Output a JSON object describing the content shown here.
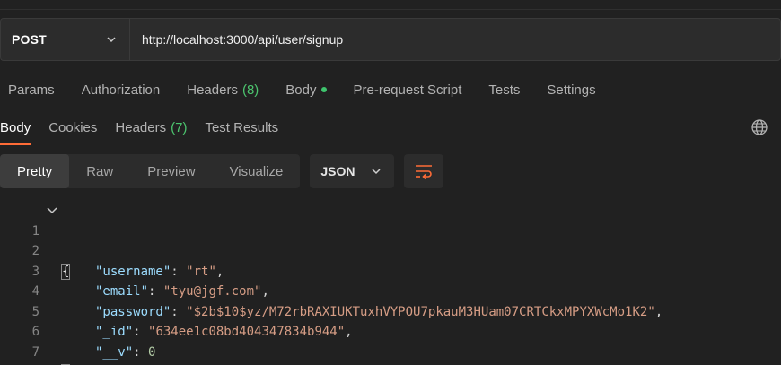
{
  "request": {
    "method": "POST",
    "url": "http://localhost:3000/api/user/signup"
  },
  "request_tabs": {
    "params": "Params",
    "authorization": "Authorization",
    "headers": "Headers",
    "headers_count": "(8)",
    "body": "Body",
    "prerequest": "Pre-request Script",
    "tests": "Tests",
    "settings": "Settings"
  },
  "response_tabs": {
    "body": "Body",
    "cookies": "Cookies",
    "headers": "Headers",
    "headers_count": "(7)",
    "test_results": "Test Results"
  },
  "view_modes": {
    "pretty": "Pretty",
    "raw": "Raw",
    "preview": "Preview",
    "visualize": "Visualize",
    "active": "Pretty"
  },
  "format": "JSON",
  "editor": {
    "line_numbers": [
      "1",
      "2",
      "3",
      "4",
      "5",
      "6",
      "7"
    ],
    "open_brace": "{",
    "close_brace": "}",
    "fields": [
      {
        "key": "\"username\"",
        "value": "\"rt\"",
        "type": "string",
        "comma": ","
      },
      {
        "key": "\"email\"",
        "value": "\"tyu@jgf.com\"",
        "type": "string",
        "comma": ","
      },
      {
        "key": "\"password\"",
        "value_prefix": "\"$2b$10$yz",
        "value_link": "/M72rbRAXIUKTuxhVYPOU7pkauM3HUam07CRTCkxMPYXWcMo1K2",
        "value_suffix": "\"",
        "type": "string",
        "comma": ","
      },
      {
        "key": "\"_id\"",
        "value": "\"634ee1c08bd404347834b944\"",
        "type": "string",
        "comma": ","
      },
      {
        "key": "\"__v\"",
        "value": "0",
        "type": "number",
        "comma": ""
      }
    ]
  },
  "colors": {
    "accent": "#ff6c37",
    "count_green": "#4cc46e",
    "background": "#212121"
  },
  "icons": {
    "method_chevron": "chevron-down-icon",
    "format_chevron": "chevron-down-icon",
    "wrap": "wrap-lines-icon",
    "globe": "globe-icon",
    "fold": "fold-chevron-icon"
  }
}
